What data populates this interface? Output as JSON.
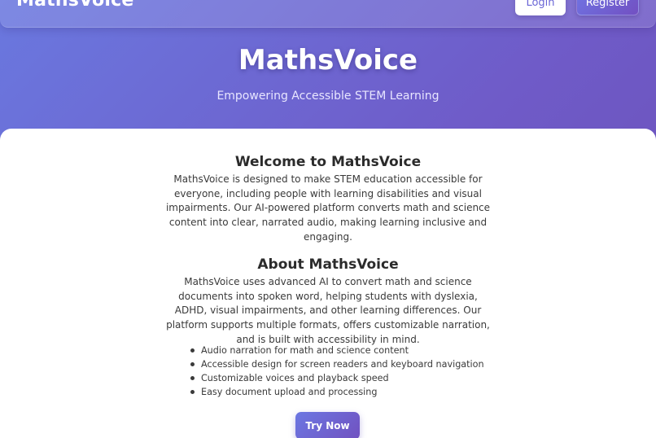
{
  "nav": {
    "brand": "MathsVoice",
    "login_label": "Login",
    "register_label": "Register"
  },
  "hero": {
    "title": "MathsVoice",
    "subtitle": "Empowering Accessible STEM Learning"
  },
  "welcome": {
    "title": "Welcome to MathsVoice",
    "text": "MathsVoice is designed to make STEM education accessible for everyone, including people with learning disabilities and visual impairments. Our AI-powered platform converts math and science content into clear, narrated audio, making learning inclusive and engaging."
  },
  "about": {
    "title": "About MathsVoice",
    "text": "MathsVoice uses advanced AI to convert math and science documents into spoken word, helping students with dyslexia, ADHD, visual impairments, and other learning differences. Our platform supports multiple formats, offers customizable narration, and is built with accessibility in mind.",
    "features": [
      "Audio narration for math and science content",
      "Accessible design for screen readers and keyboard navigation",
      "Customizable voices and playback speed",
      "Easy document upload and processing"
    ]
  },
  "cta": {
    "label": "Try Now"
  },
  "colors": {
    "gradient_start": "#6a78df",
    "gradient_end": "#6c4fb6",
    "card_background": "#ffffff",
    "text_dark": "#2b2b2b"
  }
}
